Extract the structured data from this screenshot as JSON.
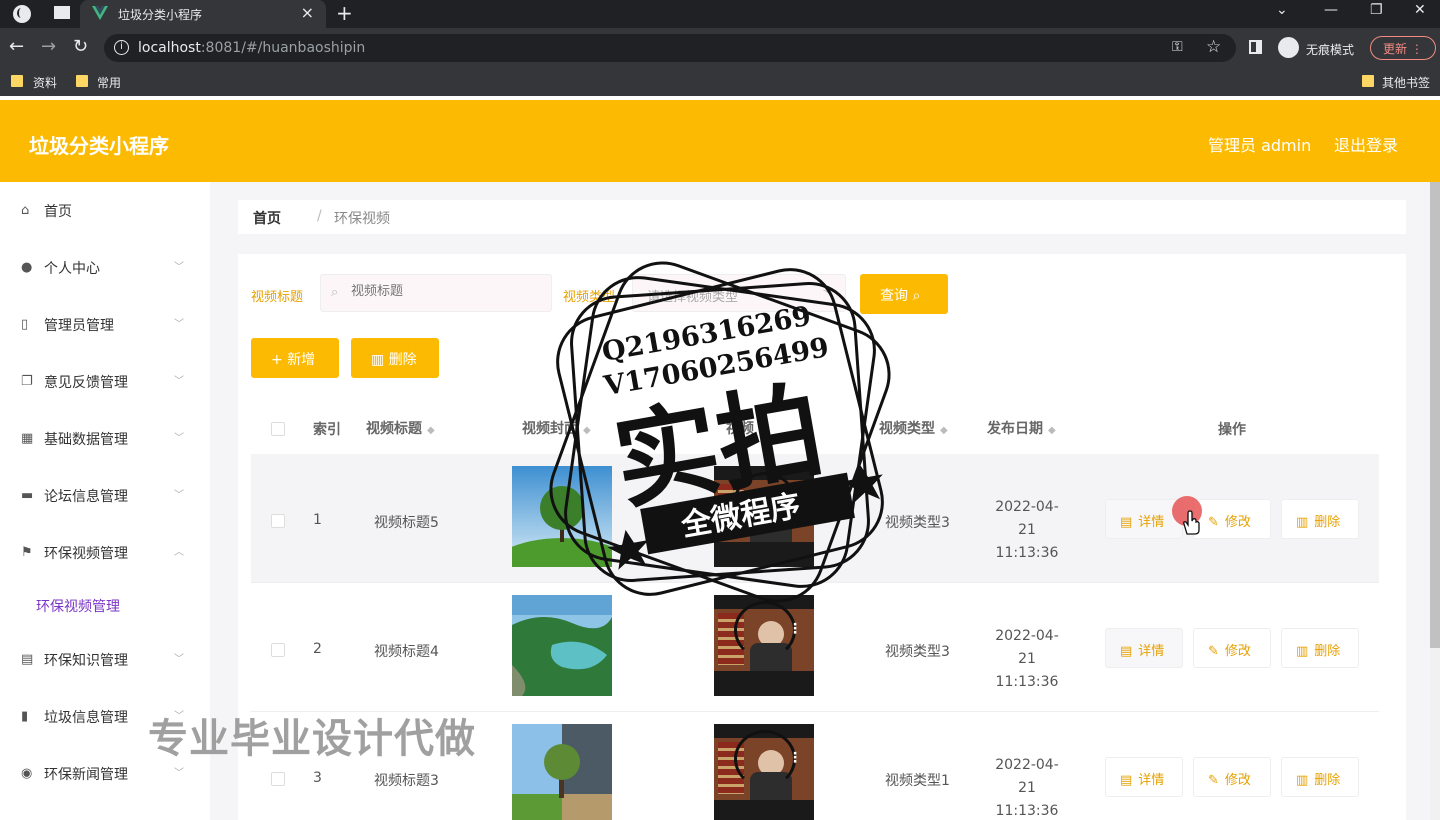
{
  "browser": {
    "tab_title": "垃圾分类小程序",
    "url_host": "localhost",
    "url_rest": ":8081/#/huanbaoshipin",
    "incognito_label": "无痕模式",
    "update_label": "更新",
    "bookmarks": [
      "资料",
      "常用"
    ],
    "other_bookmarks": "其他书签"
  },
  "app": {
    "title": "垃圾分类小程序",
    "admin_label": "管理员 admin",
    "logout_label": "退出登录",
    "accent_color": "#fcbb02"
  },
  "sidebar": {
    "items": [
      {
        "label": "首页",
        "icon": "home-icon"
      },
      {
        "label": "个人中心",
        "icon": "user-icon"
      },
      {
        "label": "管理员管理",
        "icon": "badge-icon"
      },
      {
        "label": "意见反馈管理",
        "icon": "copy-icon"
      },
      {
        "label": "基础数据管理",
        "icon": "grid-icon"
      },
      {
        "label": "论坛信息管理",
        "icon": "monitor-icon"
      },
      {
        "label": "环保视频管理",
        "icon": "flag-icon"
      },
      {
        "label": "环保知识管理",
        "icon": "document-icon"
      },
      {
        "label": "垃圾信息管理",
        "icon": "bar-chart-icon"
      },
      {
        "label": "环保新闻管理",
        "icon": "bulb-icon"
      }
    ],
    "active_submenu": "环保视频管理"
  },
  "breadcrumb": {
    "home": "首页",
    "separator": "/",
    "current": "环保视频"
  },
  "search": {
    "title_label": "视频标题",
    "title_placeholder": "视频标题",
    "type_label": "视频类型",
    "type_placeholder": "请选择视频类型",
    "query_label": "查询"
  },
  "actions": {
    "add_label": "新增",
    "delete_label": "删除"
  },
  "table": {
    "headers": {
      "index": "索引",
      "title": "视频标题",
      "cover": "视频封面",
      "video": "视频",
      "type": "视频类型",
      "date": "发布日期",
      "ops": "操作"
    },
    "rows": [
      {
        "index": "1",
        "title": "视频标题5",
        "type": "视频类型3",
        "date": "2022-04-21",
        "time": "11:13:36"
      },
      {
        "index": "2",
        "title": "视频标题4",
        "type": "视频类型3",
        "date": "2022-04-21",
        "time": "11:13:36"
      },
      {
        "index": "3",
        "title": "视频标题3",
        "type": "视频类型1",
        "date": "2022-04-21",
        "time": "11:13:36"
      }
    ],
    "op_labels": {
      "detail": "详情",
      "edit": "修改",
      "remove": "删除"
    }
  },
  "overlay": {
    "stamp_lines": [
      "Q2196316269",
      "V17060256499"
    ],
    "stamp_main": "实拍",
    "stamp_banner": "全微程序",
    "watermark": "专业毕业设计代做"
  }
}
